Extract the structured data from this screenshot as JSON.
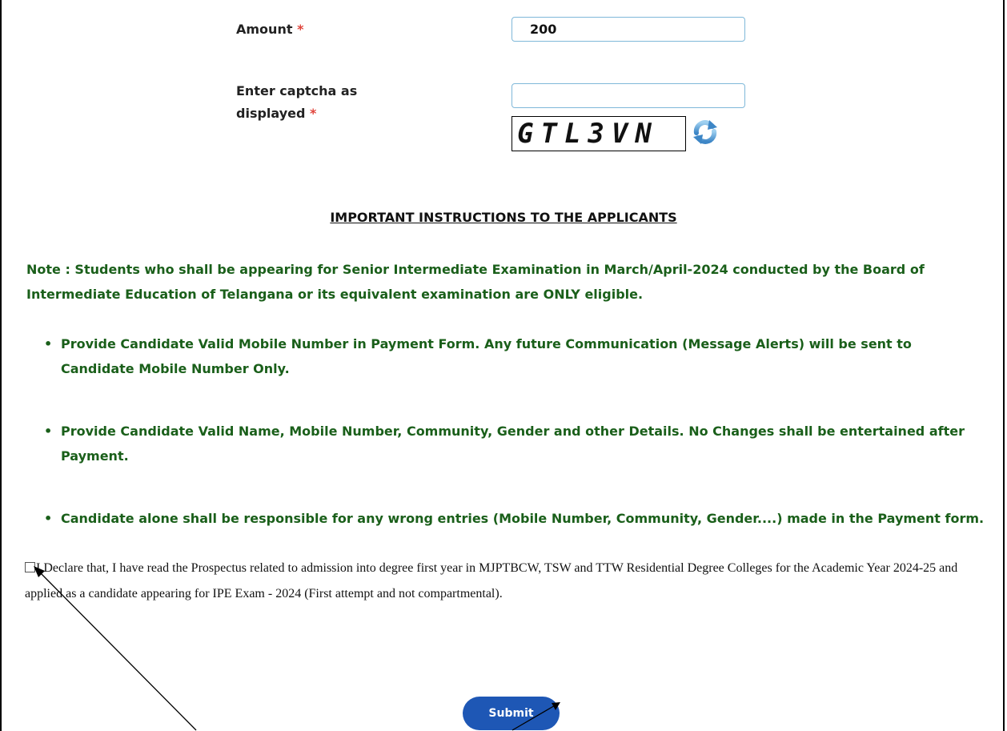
{
  "form": {
    "amount_label": "Amount",
    "amount_value": "200",
    "captcha_label": "Enter captcha as displayed",
    "captcha_value": "",
    "captcha_text": "GTL3VN",
    "required_mark": "*",
    "refresh_icon": "refresh-icon"
  },
  "instructions": {
    "heading": "IMPORTANT INSTRUCTIONS TO THE APPLICANTS",
    "note": "Note : Students who shall be appearing for Senior Intermediate Examination in March/April-2024 conducted by the Board of Intermediate Education of Telangana or its equivalent examination are ONLY eligible.",
    "bullet_mark": "•",
    "bullets": [
      "Provide Candidate Valid Mobile Number in Payment Form. Any future Communication (Message Alerts) will be sent to Candidate Mobile Number Only.",
      "Provide Candidate Valid Name, Mobile Number, Community, Gender and other Details. No Changes shall be entertained after Payment.",
      "Candidate alone shall be responsible for any wrong entries (Mobile Number, Community, Gender....) made in the Payment form."
    ]
  },
  "declaration": {
    "checked": false,
    "text": "I Declare that, I have read the Prospectus related to admission into degree first year in MJPTBCW, TSW and TTW Residential Degree Colleges for the Academic Year 2024-25 and applied as a candidate appearing for IPE Exam - 2024 (First attempt and not compartmental)."
  },
  "submit_label": "Submit",
  "colors": {
    "instruction_text": "#1a5f1a",
    "required": "#e0443b",
    "button": "#1e57b5",
    "input_border": "#7fb8d9"
  }
}
